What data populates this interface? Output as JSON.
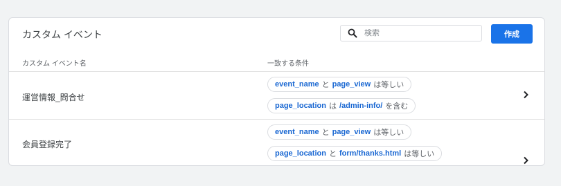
{
  "card": {
    "title": "カスタム イベント",
    "search_placeholder": "検索",
    "create_label": "作成"
  },
  "columns": {
    "name": "カスタム イベント名",
    "conditions": "一致する条件"
  },
  "rows": [
    {
      "name": "運営情報_問合せ",
      "conditions": [
        {
          "param": "event_name",
          "op": "と",
          "value": "page_view",
          "suffix": "は等しい"
        },
        {
          "param": "page_location",
          "op": "は",
          "value": "/admin-info/",
          "suffix": "を含む"
        }
      ]
    },
    {
      "name": "会員登録完了",
      "conditions": [
        {
          "param": "event_name",
          "op": "と",
          "value": "page_view",
          "suffix": "は等しい"
        },
        {
          "param": "page_location",
          "op": "と",
          "value": "form/thanks.html",
          "suffix": "は等しい"
        }
      ]
    }
  ],
  "colors": {
    "accent": "#1a73e8",
    "param_text": "#1967d2"
  }
}
